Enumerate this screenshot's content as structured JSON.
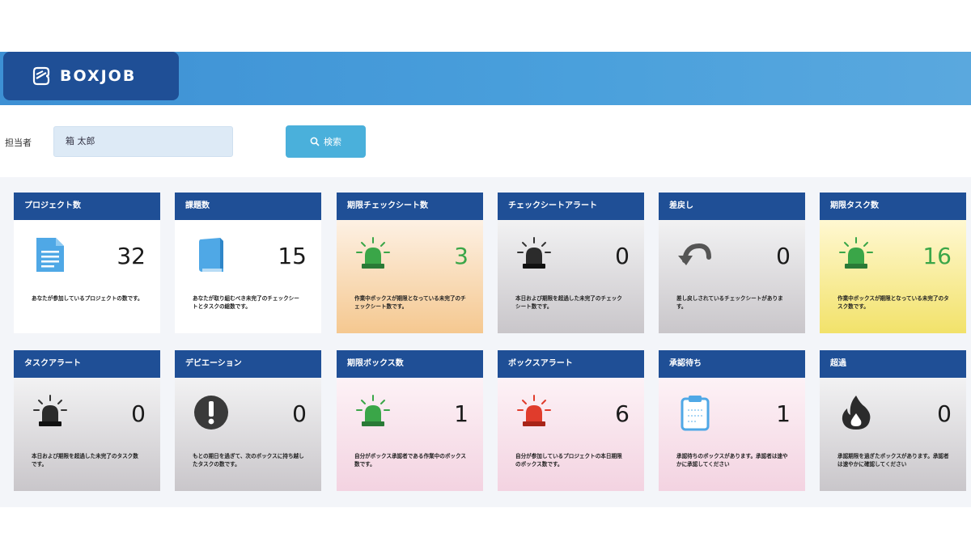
{
  "header": {
    "brand": "BOXJOB"
  },
  "filter": {
    "label": "担当者",
    "value": "箱 太郎",
    "search_label": "検索"
  },
  "cards": [
    {
      "title": "プロジェクト数",
      "value": "32",
      "icon": "document-icon",
      "desc": "あなたが参加しているプロジェクトの数です。",
      "theme": "white",
      "value_color": ""
    },
    {
      "title": "課題数",
      "value": "15",
      "icon": "book-icon",
      "desc": "あなたが取り組むべき未完了のチェックシートとタスクの総数です。",
      "theme": "white",
      "value_color": ""
    },
    {
      "title": "期限チェックシート数",
      "value": "3",
      "icon": "alarm-light-green-icon",
      "desc": "作業中ボックスが期限となっている未完了のチェックシート数です。",
      "theme": "orange",
      "value_color": "#3aa648"
    },
    {
      "title": "チェックシートアラート",
      "value": "0",
      "icon": "alarm-light-dark-icon",
      "desc": "本日および期限を超過した未完了のチェックシート数です。",
      "theme": "gray",
      "value_color": ""
    },
    {
      "title": "差戻し",
      "value": "0",
      "icon": "undo-arrow-icon",
      "desc": "差し戻しされているチェックシートがあります。",
      "theme": "gray",
      "value_color": ""
    },
    {
      "title": "期限タスク数",
      "value": "16",
      "icon": "alarm-light-green-icon",
      "desc": "作業中ボックスが期限となっている未完了のタスク数です。",
      "theme": "yellow",
      "value_color": "#3aa648"
    },
    {
      "title": "タスクアラート",
      "value": "0",
      "icon": "alarm-light-dark-icon",
      "desc": "本日および期限を超過した未完了のタスク数です。",
      "theme": "gray",
      "value_color": ""
    },
    {
      "title": "デビエーション",
      "value": "0",
      "icon": "exclamation-icon",
      "desc": "もとの期日を過ぎて、次のボックスに持ち越したタスクの数です。",
      "theme": "gray",
      "value_color": ""
    },
    {
      "title": "期限ボックス数",
      "value": "1",
      "icon": "alarm-light-green-icon",
      "desc": "自分がボックス承認者である作業中のボックス数です。",
      "theme": "pink",
      "value_color": ""
    },
    {
      "title": "ボックスアラート",
      "value": "6",
      "icon": "alarm-light-red-icon",
      "desc": "自分が参加しているプロジェクトの本日期限のボックス数です。",
      "theme": "pink",
      "value_color": ""
    },
    {
      "title": "承認待ち",
      "value": "1",
      "icon": "clipboard-icon",
      "desc": "承認待ちのボックスがあります。承認者は速やかに承認してください",
      "theme": "pink",
      "value_color": ""
    },
    {
      "title": "超過",
      "value": "0",
      "icon": "flame-icon",
      "desc": "承認期限を過ぎたボックスがあります。承認者は速やかに確認してください",
      "theme": "gray",
      "value_color": ""
    }
  ],
  "colors": {
    "brand_navy": "#1f4f96",
    "header_blue": "#4aa0dc",
    "search_button": "#4ab0db",
    "green_value": "#3aa648"
  }
}
